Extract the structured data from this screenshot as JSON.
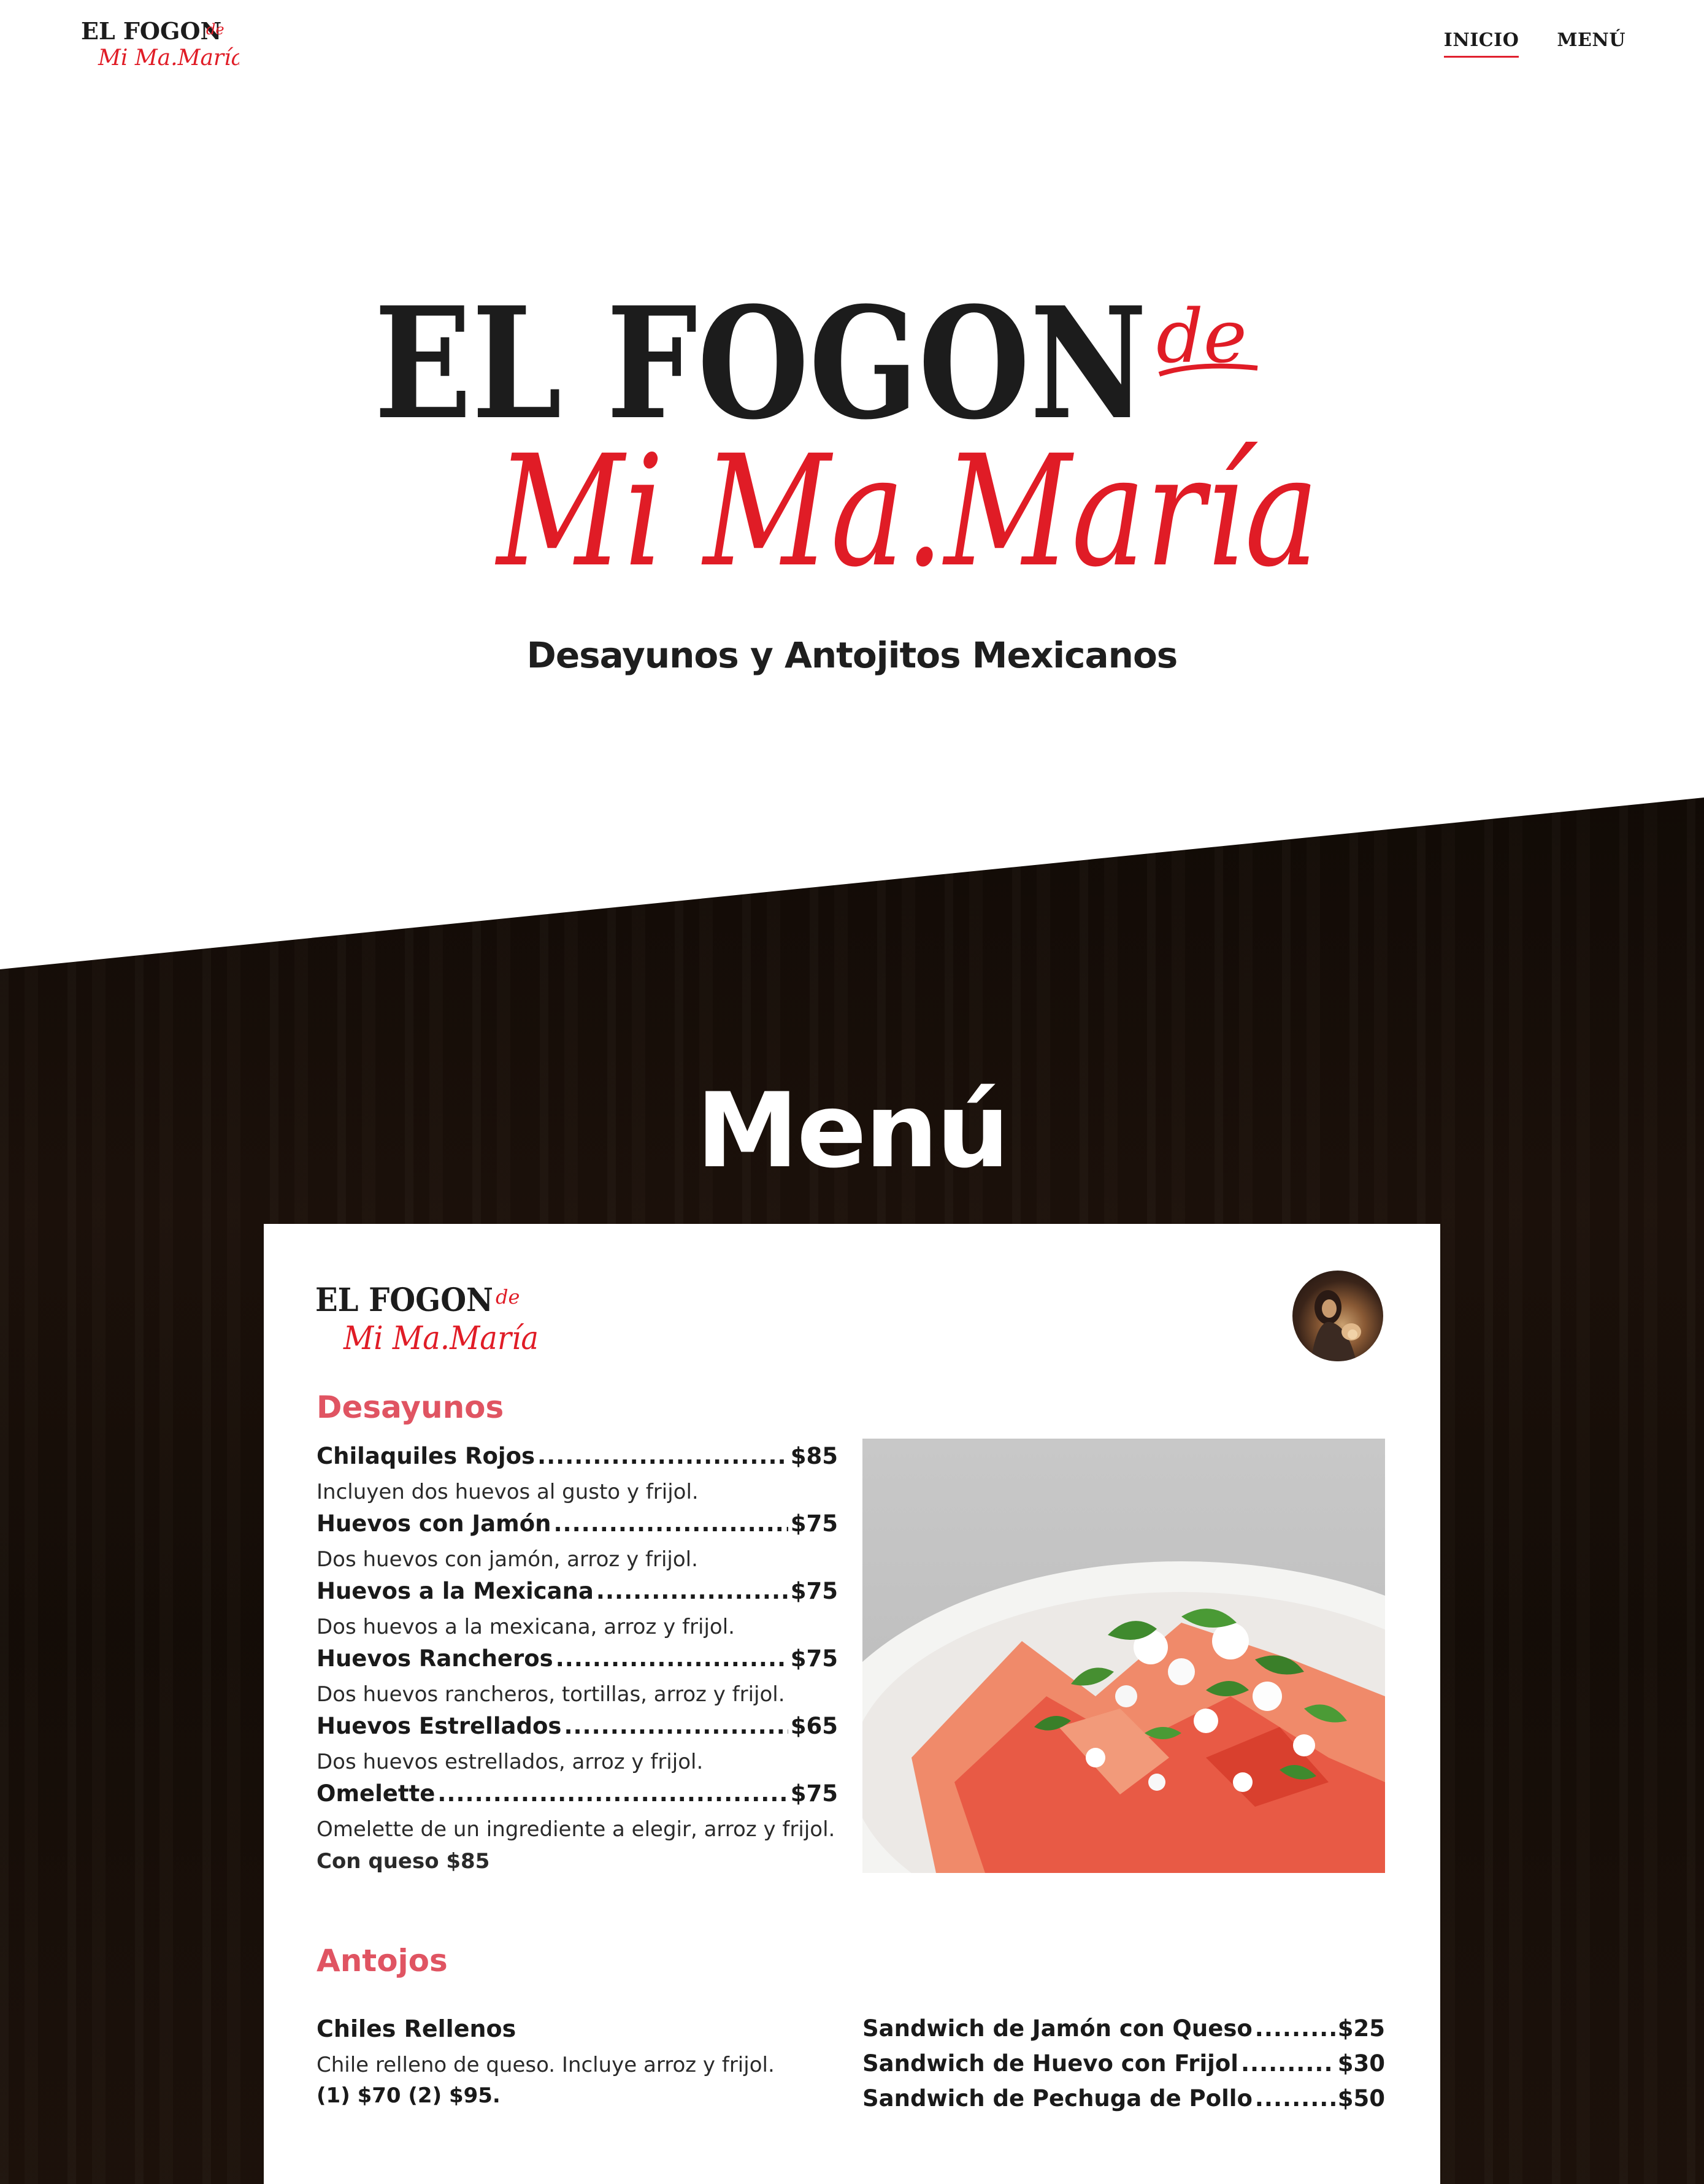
{
  "brand": {
    "line1": "EL FOGON",
    "line1_suffix": "de",
    "line2": "Mi Ma.María",
    "colors": {
      "black": "#1c1c1c",
      "red": "#e01c26",
      "accent_pink": "#e05462"
    }
  },
  "nav": {
    "links": [
      {
        "label": "INICIO",
        "active": true
      },
      {
        "label": "MENÚ",
        "active": false
      }
    ]
  },
  "hero": {
    "tagline": "Desayunos y Antojitos Mexicanos"
  },
  "menu_section": {
    "title": "Menú"
  },
  "card": {
    "desayunos": {
      "title": "Desayunos",
      "items": [
        {
          "name": "Chilaquiles Rojos",
          "price": "$85",
          "desc": "Incluyen dos huevos al gusto y frijol."
        },
        {
          "name": "Huevos con Jamón",
          "price": "$75",
          "desc": "Dos huevos con jamón, arroz y frijol."
        },
        {
          "name": "Huevos a la Mexicana",
          "price": "$75",
          "desc": "Dos huevos a la mexicana, arroz y frijol."
        },
        {
          "name": "Huevos Rancheros",
          "price": "$75",
          "desc": "Dos huevos rancheros, tortillas, arroz y frijol."
        },
        {
          "name": "Huevos Estrellados",
          "price": "$65",
          "desc": "Dos huevos estrellados, arroz y frijol."
        },
        {
          "name": "Omelette",
          "price": "$75",
          "desc": "Omelette de un ingrediente a elegir, arroz y frijol.",
          "desc_bold": "Con queso $85"
        }
      ]
    },
    "antojos": {
      "title": "Antojos",
      "left_item": {
        "name": "Chiles Rellenos",
        "desc": "Chile relleno de queso. Incluye arroz y frijol.",
        "prices": "(1) $70 (2) $95."
      },
      "right_items": [
        {
          "name": "Sandwich de Jamón con Queso",
          "price": "$25"
        },
        {
          "name": "Sandwich de Huevo con Frijol",
          "price": "$30"
        },
        {
          "name": "Sandwich de Pechuga de Pollo",
          "price": "$50"
        }
      ]
    },
    "photo_icon": "chilaquiles-photo",
    "avatar_icon": "virgin-mary-avatar"
  }
}
